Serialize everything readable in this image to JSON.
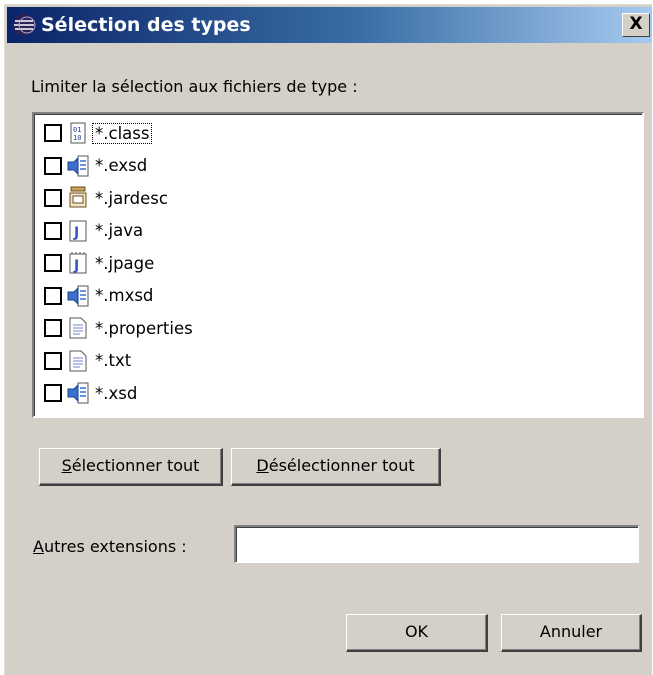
{
  "dialog": {
    "title": "Sélection des types",
    "close_label": "X",
    "prompt": "Limiter la sélection aux fichiers de type :"
  },
  "file_types": [
    {
      "label": "*.class",
      "icon": "class-file-icon",
      "checked": false
    },
    {
      "label": "*.exsd",
      "icon": "schema-file-icon",
      "checked": false
    },
    {
      "label": "*.jardesc",
      "icon": "jar-description-icon",
      "checked": false
    },
    {
      "label": "*.java",
      "icon": "java-file-icon",
      "checked": false
    },
    {
      "label": "*.jpage",
      "icon": "java-page-icon",
      "checked": false
    },
    {
      "label": "*.mxsd",
      "icon": "schema-file-icon",
      "checked": false
    },
    {
      "label": "*.properties",
      "icon": "text-file-icon",
      "checked": false
    },
    {
      "label": "*.txt",
      "icon": "text-file-icon",
      "checked": false
    },
    {
      "label": "*.xsd",
      "icon": "schema-file-icon",
      "checked": false
    }
  ],
  "buttons": {
    "select_all": {
      "mnemonic": "S",
      "rest": "électionner tout"
    },
    "deselect_all": {
      "mnemonic": "D",
      "rest": "ésélectionner tout"
    },
    "ok": "OK",
    "cancel": "Annuler"
  },
  "other_extensions": {
    "mnemonic": "A",
    "rest": "utres extensions :",
    "value": ""
  },
  "colors": {
    "dialog_bg": "#d4d0c8",
    "title_gradient_start": "#0a246a",
    "title_gradient_end": "#a6caf0"
  }
}
